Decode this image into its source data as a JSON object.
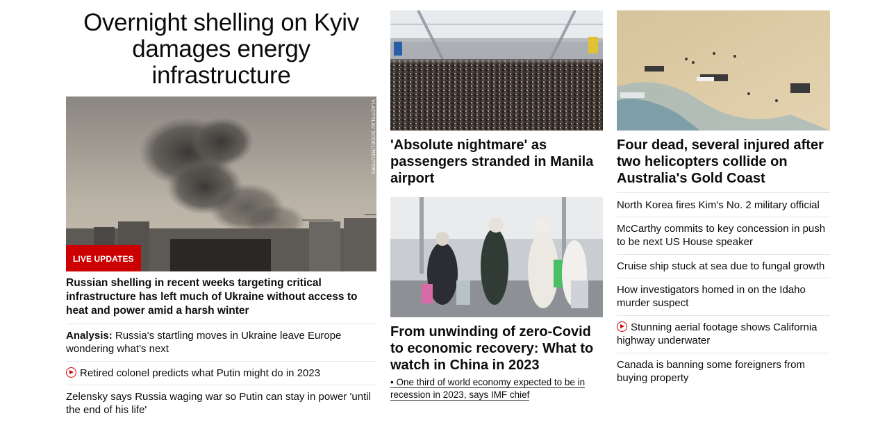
{
  "lead": {
    "headline": "Overnight shelling on Kyiv damages energy infrastructure",
    "badge": "LIVE UPDATES",
    "photo_credit": "VLADYSLAV SODEL/REUTERS",
    "subhead": "Russian shelling in recent weeks targeting critical infrastructure has left much of Ukraine without access to heat and power amid a harsh winter",
    "related": [
      {
        "prefix": "Analysis:",
        "text": " Russia's startling moves in Ukraine leave Europe wondering what's next",
        "video": false
      },
      {
        "prefix": "",
        "text": "Retired colonel predicts what Putin might do in 2023",
        "video": true
      },
      {
        "prefix": "",
        "text": "Zelensky says Russia waging war so Putin can stay in power 'until the end of his life'",
        "video": false
      }
    ]
  },
  "middle": {
    "story1_title": "'Absolute nightmare' as passengers stranded in Manila airport",
    "story2_title": "From unwinding of zero-Covid to economic recovery: What to watch in China in 2023",
    "story2_bullet": "One third of world economy expected to be in recession in 2023, says IMF chief"
  },
  "right": {
    "story_title": "Four dead, several injured after two helicopters collide on Australia's Gold Coast",
    "list": [
      {
        "text": "North Korea fires Kim's No. 2 military official",
        "video": false
      },
      {
        "text": "McCarthy commits to key concession in push to be next US House speaker",
        "video": false
      },
      {
        "text": "Cruise ship stuck at sea due to fungal growth",
        "video": false
      },
      {
        "text": "How investigators homed in on the Idaho murder suspect",
        "video": false
      },
      {
        "text": "Stunning aerial footage shows California highway underwater",
        "video": true
      },
      {
        "text": "Canada is banning some foreigners from buying property",
        "video": false
      }
    ]
  },
  "colors": {
    "accent_red": "#cc0000",
    "divider": "#e6e6e6",
    "text": "#0c0c0c"
  },
  "icons": {
    "video": "play-circle-icon"
  }
}
